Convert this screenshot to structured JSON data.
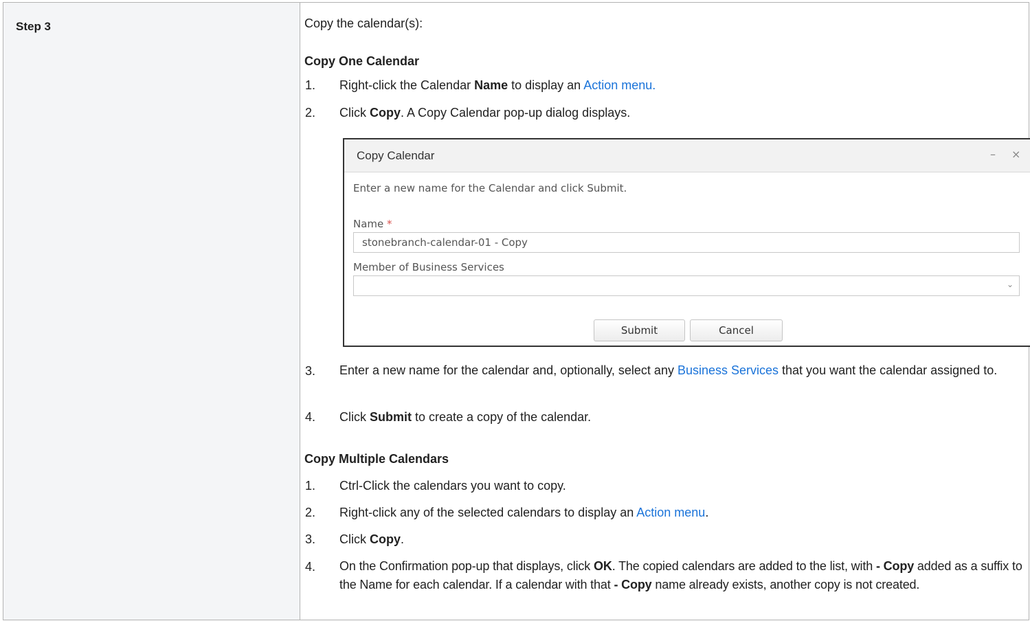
{
  "step": {
    "label": "Step 3"
  },
  "intro": "Copy the calendar(s):",
  "section1": {
    "heading": "Copy One Calendar",
    "items": [
      {
        "num": "1.",
        "pre": "Right-click the Calendar ",
        "bold": "Name",
        "mid": " to display an ",
        "link": "Action menu."
      },
      {
        "num": "2.",
        "pre": "Click ",
        "bold": "Copy",
        "post": ". A Copy Calendar pop-up dialog displays."
      },
      {
        "num": "3.",
        "pre": "Enter a new name for the calendar and, optionally, select any ",
        "link": "Business Services",
        "post": " that you want the calendar assigned to."
      },
      {
        "num": "4.",
        "pre": "Click ",
        "bold": "Submit",
        "post": " to create a copy of the calendar."
      }
    ]
  },
  "dialog": {
    "title": "Copy Calendar",
    "minimize": "–",
    "close": "×",
    "instruction": "Enter a new name for the Calendar and click Submit.",
    "name_label": "Name",
    "required_mark": "*",
    "name_value": "stonebranch-calendar-01 - Copy",
    "services_label": "Member of Business Services",
    "services_value": "",
    "submit": "Submit",
    "cancel": "Cancel"
  },
  "section2": {
    "heading": "Copy Multiple Calendars",
    "items": [
      {
        "num": "1.",
        "text": "Ctrl-Click the calendars you want to copy."
      },
      {
        "num": "2.",
        "pre": "Right-click any of the selected calendars to display an ",
        "link": "Action menu",
        "post": "."
      },
      {
        "num": "3.",
        "pre": "Click ",
        "bold": "Copy",
        "post": "."
      },
      {
        "num": "4.",
        "pre": "On the Confirmation pop-up that displays, click ",
        "bold": "OK",
        "mid": ". The copied calendars are added to the list, with ",
        "bold2": "- Copy",
        "mid2": " added as a suffix to the Name for each calendar. If a calendar with that ",
        "bold3": "- Copy",
        "post": " name already exists, another copy is not created."
      }
    ]
  },
  "colors": {
    "link": "#1a73d9",
    "step_bg": "#f4f5f7",
    "required": "#d9534f"
  }
}
